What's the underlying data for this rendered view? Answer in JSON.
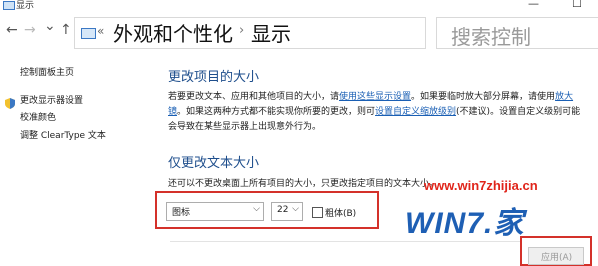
{
  "window": {
    "title": "显示",
    "controls": {
      "minimize": "—",
      "maximize": "☐"
    }
  },
  "nav": {
    "back": "←",
    "forward": "→",
    "history": "⌄",
    "up": "↑"
  },
  "address": {
    "chevrons": "«",
    "crumbs": [
      "外观和个性化",
      "显示"
    ],
    "separator": "›"
  },
  "search": {
    "placeholder": "搜索控制"
  },
  "sidebar": {
    "items": [
      {
        "label": "控制面板主页"
      },
      {
        "label": "更改显示器设置"
      },
      {
        "label": "校准颜色"
      },
      {
        "label": "调整 ClearType 文本"
      }
    ]
  },
  "section1": {
    "heading": "更改项目的大小",
    "line1_pre": "若要更改文本、应用和其他项目的大小，请",
    "line1_link": "使用这些显示设置",
    "line1_post": "。如果要临时放大部分屏幕，请使用",
    "line1_link2": "放大",
    "line2_link": "镜",
    "line2_mid": "。如果这两种方式都不能实现你所要的更改，则可",
    "line2_link3": "设置自定义缩放级别",
    "line2_post": "(不建议)。设置自定义级别可能",
    "line3": "会导致在某些显示器上出现意外行为。"
  },
  "section2": {
    "heading": "仅更改文本大小",
    "description": "还可以不更改桌面上所有项目的大小，只更改指定项目的文本大小。",
    "item_select": "图标",
    "size_select": "22",
    "bold_label": "粗体(B)",
    "bold_checked": false
  },
  "footer": {
    "apply_label": "应用(A)"
  },
  "watermark": {
    "url": "www.win7zhijia.cn",
    "logo": "WIN7.家"
  },
  "colors": {
    "accent": "#1e4e8c",
    "link": "#1a5fb4",
    "highlight": "#d4312a"
  }
}
